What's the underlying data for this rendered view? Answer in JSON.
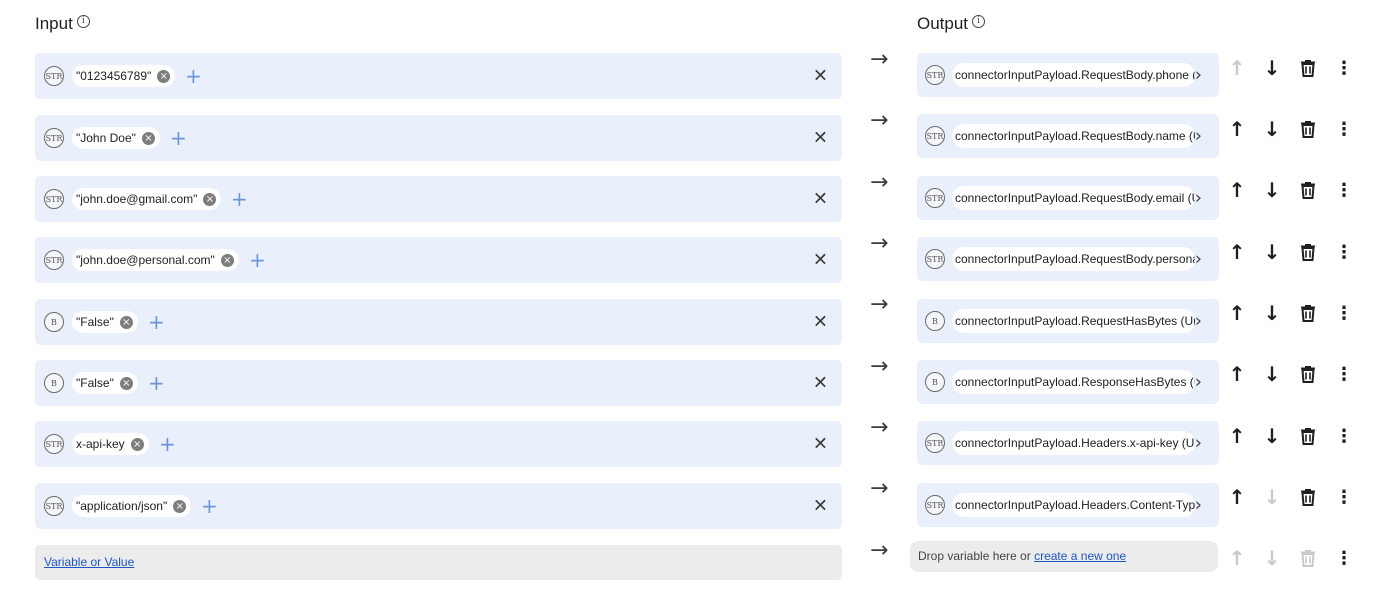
{
  "input": {
    "title": "Input",
    "info_icon": "info-icon",
    "rows": [
      {
        "type": "STR",
        "value": "\"0123456789\""
      },
      {
        "type": "STR",
        "value": "\"John Doe\""
      },
      {
        "type": "STR",
        "value": "\"john.doe@gmail.com\""
      },
      {
        "type": "STR",
        "value": "\"john.doe@personal.com\""
      },
      {
        "type": "B",
        "value": "\"False\""
      },
      {
        "type": "B",
        "value": "\"False\""
      },
      {
        "type": "STR",
        "value": "x-api-key"
      },
      {
        "type": "STR",
        "value": "\"application/json\""
      }
    ],
    "add_link": "Variable or Value"
  },
  "output": {
    "title": "Output",
    "info_icon": "info-icon",
    "rows": [
      {
        "type": "STR",
        "value": "connectorInputPayload.RequestBody.phone (Upload Contact)"
      },
      {
        "type": "STR",
        "value": "connectorInputPayload.RequestBody.name (Upload Contact)"
      },
      {
        "type": "STR",
        "value": "connectorInputPayload.RequestBody.email (Upload Contact)"
      },
      {
        "type": "STR",
        "value": "connectorInputPayload.RequestBody.personal_email (Upload Contact)"
      },
      {
        "type": "B",
        "value": "connectorInputPayload.RequestHasBytes (Upload Contact)"
      },
      {
        "type": "B",
        "value": "connectorInputPayload.ResponseHasBytes (Upload Contact)"
      },
      {
        "type": "STR",
        "value": "connectorInputPayload.Headers.x-api-key (Upload Contact)"
      },
      {
        "type": "STR",
        "value": "connectorInputPayload.Headers.Content-Type (Upload Contact)"
      }
    ],
    "drop_text": "Drop variable here or",
    "drop_link": "create a new one"
  },
  "icons": {
    "mapping_arrow": "arrow-right-icon",
    "clear": "close-icon",
    "add": "plus-icon",
    "move_up": "arrow-up-icon",
    "move_down": "arrow-down-icon",
    "delete": "trash-icon",
    "more": "more-vert-icon",
    "expand": "chevron-right-icon"
  },
  "colors": {
    "row_bg": "#e9f0fb",
    "empty_row_bg": "#ececec",
    "link": "#1a56c4",
    "plus": "#6a95d6",
    "disabled_icon": "#c9c9c9"
  }
}
